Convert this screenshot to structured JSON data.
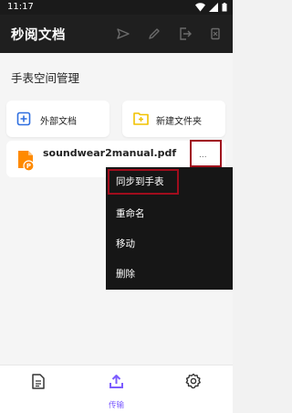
{
  "status_bar": {
    "time": "11:17"
  },
  "app_bar": {
    "title": "秒阅文档",
    "tools": [
      "send-icon",
      "edit-icon",
      "export-icon",
      "delete-icon"
    ]
  },
  "section": {
    "title": "手表空间管理"
  },
  "actions": [
    {
      "label": "外部文档",
      "icon": "external-doc-icon"
    },
    {
      "label": "新建文件夹",
      "icon": "new-folder-icon"
    }
  ],
  "file": {
    "name": "soundwear2manual.pdf",
    "icon": "pdf-file-icon",
    "more": "..."
  },
  "menu": {
    "items": [
      "同步到手表",
      "重命名",
      "移动",
      "删除"
    ]
  },
  "bottom_nav": {
    "items": [
      {
        "icon": "document-icon",
        "label": ""
      },
      {
        "icon": "upload-icon",
        "label": "传输"
      },
      {
        "icon": "settings-icon",
        "label": ""
      }
    ]
  },
  "colors": {
    "accent": "#7c5cff",
    "highlight_border": "#a00d1d",
    "folder": "#f2c200",
    "pdf": "#ff8a00"
  }
}
